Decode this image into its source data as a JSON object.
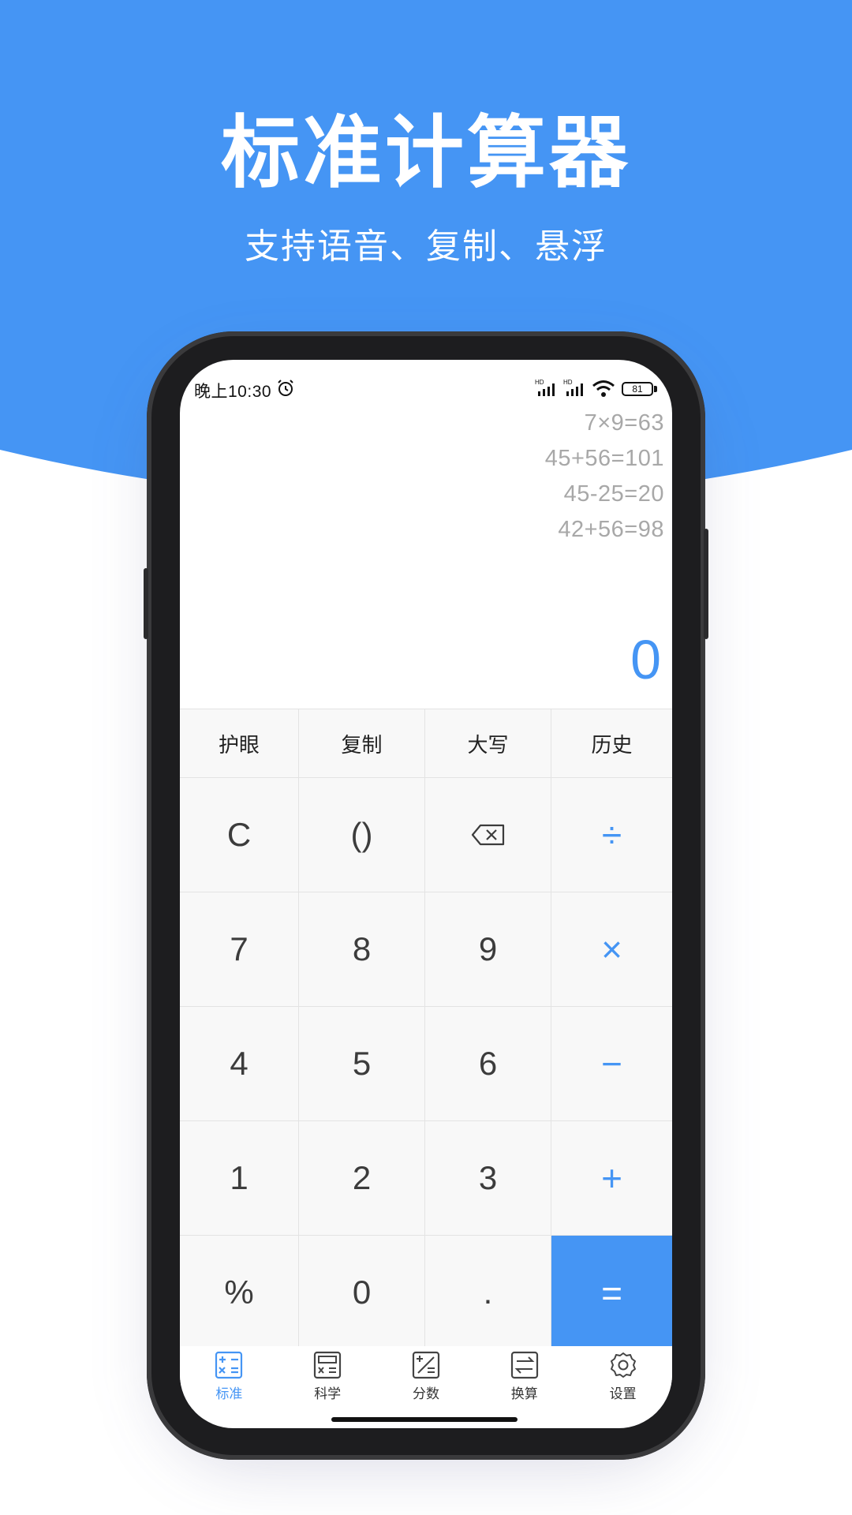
{
  "colors": {
    "accent": "#4595f4",
    "background": "#ffffff",
    "phone_frame": "#1d1d1f",
    "history_text": "#a8a8a8"
  },
  "hero": {
    "title": "标准计算器",
    "subtitle": "支持语音、复制、悬浮"
  },
  "status_bar": {
    "time": "晚上10:30",
    "battery": "81",
    "icons": [
      "alarm-icon",
      "signal-hd-icon",
      "signal-hd-icon",
      "wifi-icon",
      "battery-icon"
    ]
  },
  "history": [
    "7×9=63",
    "45+56=101",
    "45-25=20",
    "42+56=98"
  ],
  "display": {
    "value": "0"
  },
  "function_row": [
    "护眼",
    "复制",
    "大写",
    "历史"
  ],
  "keypad": {
    "rows": [
      [
        "C",
        "()",
        "backspace",
        "÷"
      ],
      [
        "7",
        "8",
        "9",
        "×"
      ],
      [
        "4",
        "5",
        "6",
        "−"
      ],
      [
        "1",
        "2",
        "3",
        "+"
      ],
      [
        "%",
        "0",
        ".",
        "="
      ]
    ]
  },
  "tabs": [
    {
      "label": "标准",
      "icon": "standard-calc-icon",
      "active": true
    },
    {
      "label": "科学",
      "icon": "scientific-calc-icon",
      "active": false
    },
    {
      "label": "分数",
      "icon": "fraction-icon",
      "active": false
    },
    {
      "label": "换算",
      "icon": "convert-icon",
      "active": false
    },
    {
      "label": "设置",
      "icon": "settings-icon",
      "active": false
    }
  ]
}
